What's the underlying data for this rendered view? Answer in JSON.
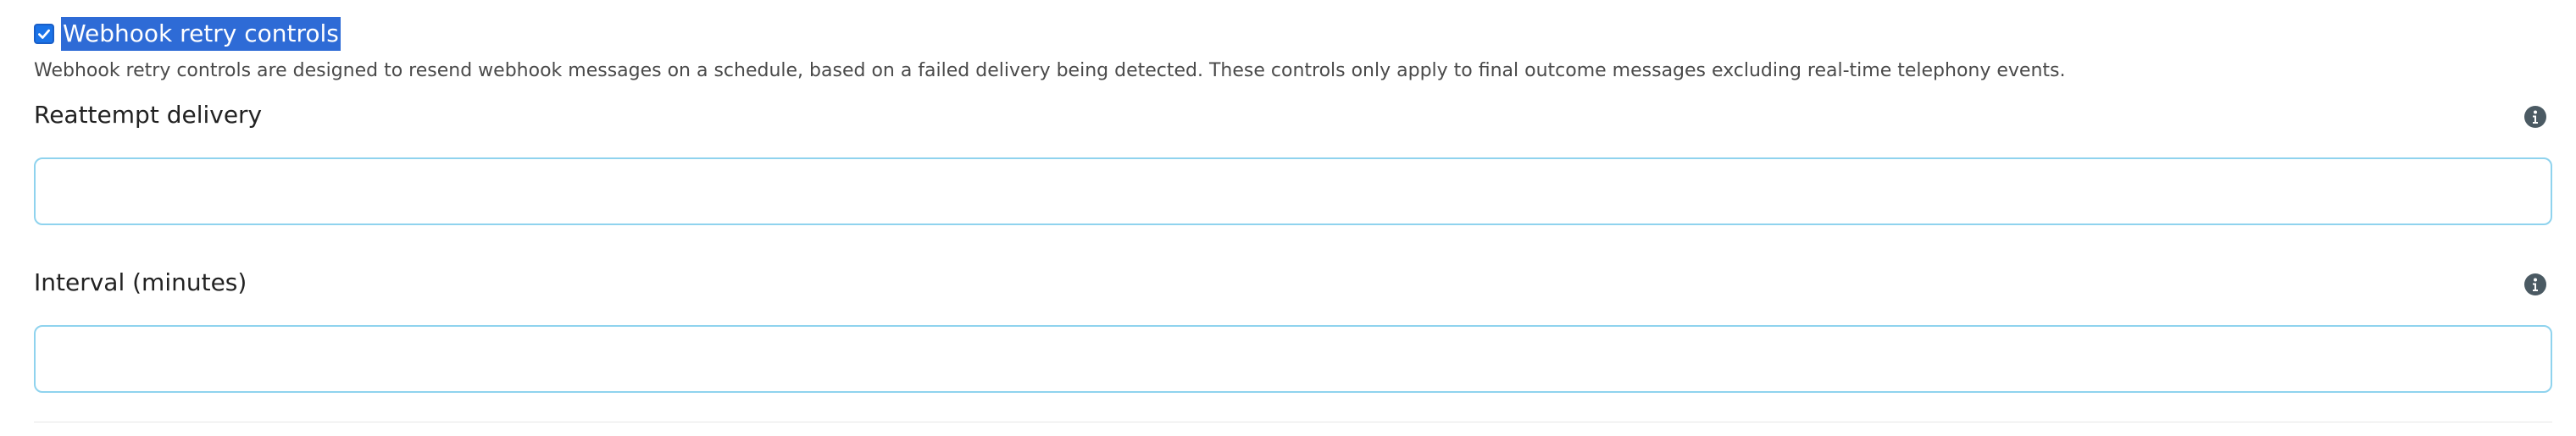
{
  "webhook": {
    "checkbox_checked": true,
    "checkbox_label": "Webhook retry controls",
    "description": "Webhook retry controls are designed to resend webhook messages on a schedule, based on a failed delivery being detected. These controls only apply to final outcome messages excluding real-time telephony events."
  },
  "fields": {
    "reattempt": {
      "label": "Reattempt delivery",
      "value": "",
      "placeholder": ""
    },
    "interval": {
      "label": "Interval (minutes)",
      "value": "",
      "placeholder": ""
    }
  },
  "icons": {
    "info": "info-icon",
    "check": "check-icon"
  },
  "colors": {
    "accent": "#1a73e8",
    "selection": "#2e6bd6",
    "input_border": "#8fd3ee",
    "info_icon": "#4b5a63"
  }
}
